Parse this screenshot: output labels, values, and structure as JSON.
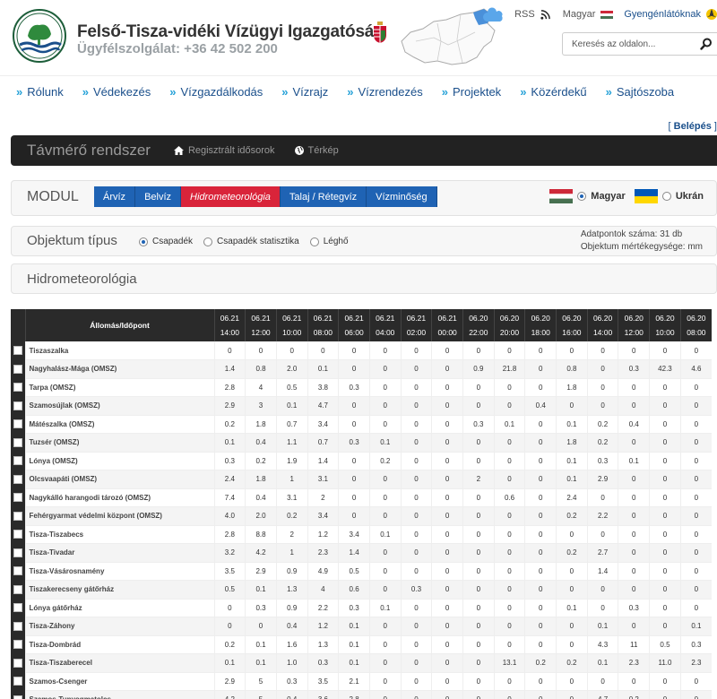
{
  "header": {
    "org_name": "Felső-Tisza-vidéki Vízügyi Igazgatóság",
    "phone": "Ügyfélszolgálat: +36 42 502 200",
    "logo_text": "FETIVIZIG"
  },
  "top_links": {
    "rss": "RSS",
    "language": "Magyar",
    "accessibility": "Gyengénlátóknak"
  },
  "search": {
    "placeholder": "Keresés az oldalon..."
  },
  "nav": {
    "items": [
      "Rólunk",
      "Védekezés",
      "Vízgazdálkodás",
      "Vízrajz",
      "Vízrendezés",
      "Projektek",
      "Közérdekű",
      "Sajtószoba"
    ]
  },
  "login": {
    "label": "Belépés"
  },
  "system": {
    "title": "Távmérő rendszer",
    "links": [
      "Regisztrált idősorok",
      "Térkép"
    ]
  },
  "module": {
    "label": "MODUL",
    "tabs": [
      "Árvíz",
      "Belvíz",
      "Hidrometeorológia",
      "Talaj / Rétegvíz",
      "Vízminőség"
    ],
    "active_tab": "Hidrometeorológia",
    "languages": [
      "Magyar",
      "Ukrán"
    ],
    "selected_language": "Magyar"
  },
  "object_type": {
    "label": "Objektum típus",
    "options": [
      "Csapadék",
      "Csapadék statisztika",
      "Léghő"
    ],
    "selected": "Csapadék",
    "info_count": "Adatpontok száma: 31 db",
    "info_unit": "Objektum mértékegysége: mm"
  },
  "section": {
    "title": "Hidrometeorológia"
  },
  "table": {
    "header_label": "Állomás/Időpont",
    "columns": [
      {
        "date": "06.21",
        "time": "14:00"
      },
      {
        "date": "06.21",
        "time": "12:00"
      },
      {
        "date": "06.21",
        "time": "10:00"
      },
      {
        "date": "06.21",
        "time": "08:00"
      },
      {
        "date": "06.21",
        "time": "06:00"
      },
      {
        "date": "06.21",
        "time": "04:00"
      },
      {
        "date": "06.21",
        "time": "02:00"
      },
      {
        "date": "06.21",
        "time": "00:00"
      },
      {
        "date": "06.20",
        "time": "22:00"
      },
      {
        "date": "06.20",
        "time": "20:00"
      },
      {
        "date": "06.20",
        "time": "18:00"
      },
      {
        "date": "06.20",
        "time": "16:00"
      },
      {
        "date": "06.20",
        "time": "14:00"
      },
      {
        "date": "06.20",
        "time": "12:00"
      },
      {
        "date": "06.20",
        "time": "10:00"
      },
      {
        "date": "06.20",
        "time": "08:00"
      }
    ],
    "rows": [
      {
        "name": "Tiszaszalka",
        "values": [
          "0",
          "0",
          "0",
          "0",
          "0",
          "0",
          "0",
          "0",
          "0",
          "0",
          "0",
          "0",
          "0",
          "0",
          "0",
          "0"
        ]
      },
      {
        "name": "Nagyhalász-Mága (OMSZ)",
        "values": [
          "1.4",
          "0.8",
          "2.0",
          "0.1",
          "0",
          "0",
          "0",
          "0",
          "0.9",
          "21.8",
          "0",
          "0.8",
          "0",
          "0.3",
          "42.3",
          "4.6"
        ]
      },
      {
        "name": "Tarpa (OMSZ)",
        "values": [
          "2.8",
          "4",
          "0.5",
          "3.8",
          "0.3",
          "0",
          "0",
          "0",
          "0",
          "0",
          "0",
          "1.8",
          "0",
          "0",
          "0",
          "0"
        ]
      },
      {
        "name": "Szamosújlak (OMSZ)",
        "values": [
          "2.9",
          "3",
          "0.1",
          "4.7",
          "0",
          "0",
          "0",
          "0",
          "0",
          "0",
          "0.4",
          "0",
          "0",
          "0",
          "0",
          "0"
        ]
      },
      {
        "name": "Mátészalka (OMSZ)",
        "values": [
          "0.2",
          "1.8",
          "0.7",
          "3.4",
          "0",
          "0",
          "0",
          "0",
          "0.3",
          "0.1",
          "0",
          "0.1",
          "0.2",
          "0.4",
          "0",
          "0"
        ]
      },
      {
        "name": "Tuzsér (OMSZ)",
        "values": [
          "0.1",
          "0.4",
          "1.1",
          "0.7",
          "0.3",
          "0.1",
          "0",
          "0",
          "0",
          "0",
          "0",
          "1.8",
          "0.2",
          "0",
          "0",
          "0"
        ]
      },
      {
        "name": "Lónya (OMSZ)",
        "values": [
          "0.3",
          "0.2",
          "1.9",
          "1.4",
          "0",
          "0.2",
          "0",
          "0",
          "0",
          "0",
          "0",
          "0.1",
          "0.3",
          "0.1",
          "0",
          "0"
        ]
      },
      {
        "name": "Olcsvaapáti (OMSZ)",
        "values": [
          "2.4",
          "1.8",
          "1",
          "3.1",
          "0",
          "0",
          "0",
          "0",
          "2",
          "0",
          "0",
          "0.1",
          "2.9",
          "0",
          "0",
          "0"
        ]
      },
      {
        "name": "Nagykálló harangodi tározó (OMSZ)",
        "values": [
          "7.4",
          "0.4",
          "3.1",
          "2",
          "0",
          "0",
          "0",
          "0",
          "0",
          "0.6",
          "0",
          "2.4",
          "0",
          "0",
          "0",
          "0"
        ]
      },
      {
        "name": "Fehérgyarmat védelmi központ (OMSZ)",
        "values": [
          "4.0",
          "2.0",
          "0.2",
          "3.4",
          "0",
          "0",
          "0",
          "0",
          "0",
          "0",
          "0",
          "0.2",
          "2.2",
          "0",
          "0",
          "0"
        ]
      },
      {
        "name": "Tisza-Tiszabecs",
        "values": [
          "2.8",
          "8.8",
          "2",
          "1.2",
          "3.4",
          "0.1",
          "0",
          "0",
          "0",
          "0",
          "0",
          "0",
          "0",
          "0",
          "0",
          "0"
        ]
      },
      {
        "name": "Tisza-Tivadar",
        "values": [
          "3.2",
          "4.2",
          "1",
          "2.3",
          "1.4",
          "0",
          "0",
          "0",
          "0",
          "0",
          "0",
          "0.2",
          "2.7",
          "0",
          "0",
          "0"
        ]
      },
      {
        "name": "Tisza-Vásárosnamény",
        "values": [
          "3.5",
          "2.9",
          "0.9",
          "4.9",
          "0.5",
          "0",
          "0",
          "0",
          "0",
          "0",
          "0",
          "0",
          "1.4",
          "0",
          "0",
          "0"
        ]
      },
      {
        "name": "Tiszakerecseny gátőrház",
        "values": [
          "0.5",
          "0.1",
          "1.3",
          "4",
          "0.6",
          "0",
          "0.3",
          "0",
          "0",
          "0",
          "0",
          "0",
          "0",
          "0",
          "0",
          "0"
        ]
      },
      {
        "name": "Lónya gátőrház",
        "values": [
          "0",
          "0.3",
          "0.9",
          "2.2",
          "0.3",
          "0.1",
          "0",
          "0",
          "0",
          "0",
          "0",
          "0.1",
          "0",
          "0.3",
          "0",
          "0"
        ]
      },
      {
        "name": "Tisza-Záhony",
        "values": [
          "0",
          "0",
          "0.4",
          "1.2",
          "0.1",
          "0",
          "0",
          "0",
          "0",
          "0",
          "0",
          "0",
          "0.1",
          "0",
          "0",
          "0.1"
        ]
      },
      {
        "name": "Tisza-Dombrád",
        "values": [
          "0.2",
          "0.1",
          "1.6",
          "1.3",
          "0.1",
          "0",
          "0",
          "0",
          "0",
          "0",
          "0",
          "0",
          "4.3",
          "11",
          "0.5",
          "0.3"
        ]
      },
      {
        "name": "Tisza-Tiszaberecel",
        "values": [
          "0.1",
          "0.1",
          "1.0",
          "0.3",
          "0.1",
          "0",
          "0",
          "0",
          "0",
          "13.1",
          "0.2",
          "0.2",
          "0.1",
          "2.3",
          "11.0",
          "2.3"
        ]
      },
      {
        "name": "Szamos-Csenger",
        "values": [
          "2.9",
          "5",
          "0.3",
          "3.5",
          "2.1",
          "0",
          "0",
          "0",
          "0",
          "0",
          "0",
          "0",
          "0",
          "0",
          "0",
          "0"
        ]
      },
      {
        "name": "Szamos-Tunyogmatolcs",
        "values": [
          "4.2",
          "5",
          "0.4",
          "3.6",
          "2.8",
          "0",
          "0",
          "0",
          "0",
          "0",
          "0",
          "0",
          "4.7",
          "0.2",
          "0",
          "0"
        ]
      }
    ]
  },
  "colors": {
    "accent_blue": "#1f63b4",
    "active_red": "#d9243a",
    "nav_text": "#1a4f8b",
    "dark_bar": "#222222"
  }
}
